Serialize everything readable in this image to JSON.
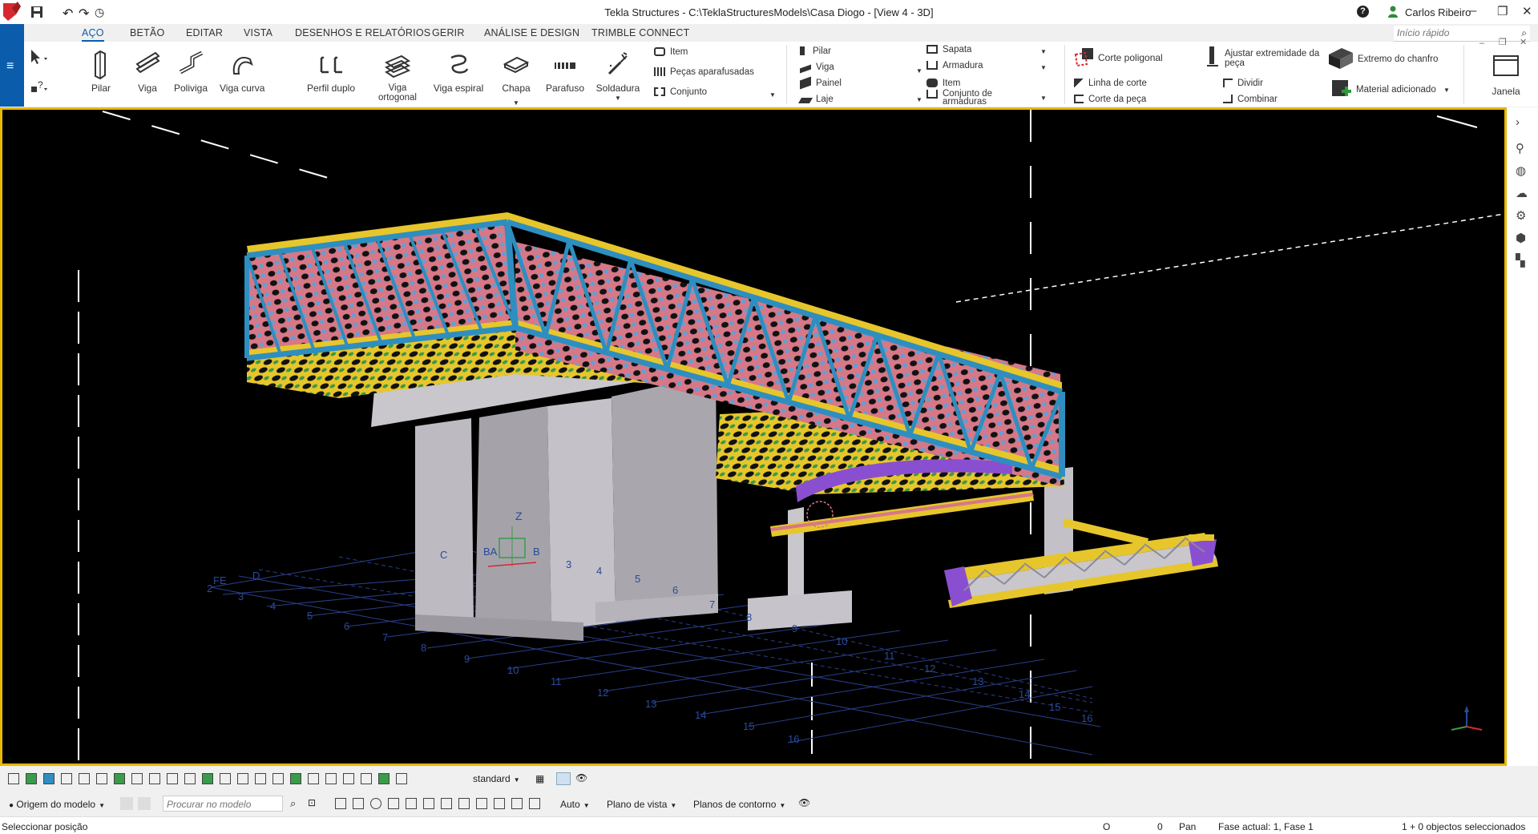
{
  "window": {
    "title": "Tekla Structures - C:\\TeklaStructuresModels\\Casa Diogo  - [View 4 - 3D]",
    "user": "Carlos Ribeiro",
    "help_label": "?",
    "minimize": "–",
    "maximize": "❐",
    "close": "✕"
  },
  "tabs": [
    "AÇO",
    "BETÃO",
    "EDITAR",
    "VISTA",
    "DESENHOS E RELATÓRIOS",
    "GERIR",
    "ANÁLISE E DESIGN",
    "TRIMBLE CONNECT"
  ],
  "active_tab": "AÇO",
  "quick_search": {
    "placeholder": "Início rápido"
  },
  "ribbon": {
    "large_buttons": [
      {
        "label": "Pilar",
        "icon": "column-icon"
      },
      {
        "label": "Viga",
        "icon": "beam-icon"
      },
      {
        "label": "Polivi­ga",
        "icon": "polybeam-icon"
      },
      {
        "label": "Viga curva",
        "icon": "curved-beam-icon"
      },
      {
        "label": "Perfil duplo",
        "icon": "twin-profile-icon"
      },
      {
        "label": "Viga ortogonal",
        "icon": "orthogonal-beam-icon"
      },
      {
        "label": "Viga espiral",
        "icon": "spiral-beam-icon"
      },
      {
        "label": "Chapa",
        "icon": "plate-icon"
      },
      {
        "label": "Parafuso",
        "icon": "bolt-icon"
      },
      {
        "label": "Soldadura",
        "icon": "weld-icon"
      }
    ],
    "steel_small": [
      "Item",
      "Peças aparafusadas",
      "Conjunto"
    ],
    "concrete_small_left": [
      "Pilar",
      "Viga",
      "Painel",
      "Laje"
    ],
    "concrete_small_right": [
      "Sapata",
      "Armadura",
      "Item",
      "Conjunto de armaduras"
    ],
    "cut_small": [
      "Corte poligonal",
      "Linha de corte",
      "Corte da peça"
    ],
    "edit_small": [
      "Ajustar extremidade da peça",
      "Dividir",
      "Combinar"
    ],
    "chamfer": [
      "Extremo do chanfro",
      "Material adicionado"
    ],
    "window_label": "Janela"
  },
  "viewport": {
    "axis_letters": [
      "FE",
      "D",
      "C",
      "BA",
      "B"
    ],
    "axis_numbers": [
      "2",
      "3",
      "4",
      "5",
      "6",
      "7",
      "8",
      "9",
      "10",
      "11",
      "12",
      "13",
      "14",
      "15",
      "16"
    ],
    "grid_labels_near": [
      "3",
      "4",
      "5",
      "6",
      "7",
      "8",
      "9",
      "10",
      "11",
      "12",
      "13",
      "14",
      "15",
      "16"
    ],
    "z_label": "Z",
    "bridge_colors": {
      "truss": "#2e8ec0",
      "flange": "#e7c62c",
      "deck": "#c05a66",
      "bracing": "#8a4fd0",
      "concrete": "#c9c7cc"
    }
  },
  "toolbar_bottom": {
    "view_filter": "standard",
    "origin": "Origem do modelo",
    "search_placeholder": "Procurar no modelo",
    "snap_mode": "Auto",
    "view_plane": "Plano de vista",
    "contour_planes": "Planos de contorno"
  },
  "status": {
    "prompt": "Seleccionar posição",
    "o_label": "O",
    "zero": "0",
    "pan": "Pan",
    "phase": "Fase actual: 1, Fase 1",
    "selection": "1 + 0 objectos seleccionados"
  }
}
